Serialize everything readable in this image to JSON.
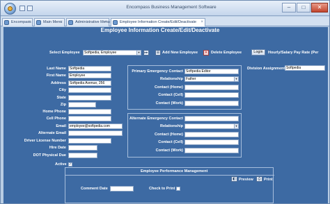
{
  "window": {
    "title": "Encompass Business Management Software",
    "watermark": "SOFTPEDIA"
  },
  "tabs": [
    {
      "label": "Encompass",
      "active": false
    },
    {
      "label": "Main Menu",
      "active": false
    },
    {
      "label": "Administrative Menu",
      "active": false
    },
    {
      "label": "Employee Information Create/Edit/Deactivate",
      "active": true
    }
  ],
  "form": {
    "heading": "Employee Information Create/Edit/Deactivate",
    "select_employee_label": "Select Employee",
    "select_employee_value": "Softpedia, Employee",
    "add_new_label": "Add New Employee",
    "delete_label": "Delete Employee",
    "login_button": "Login",
    "hourly_rate_label": "Hourly/Salary Pay Rate (Per",
    "left_fields": [
      {
        "label": "Last Name",
        "value": "Softpedia"
      },
      {
        "label": "First Name",
        "value": "Employee"
      },
      {
        "label": "Address",
        "value": "Softpedia Avenue, 256"
      },
      {
        "label": "City",
        "value": ""
      },
      {
        "label": "State",
        "value": ""
      },
      {
        "label": "Zip",
        "value": ""
      },
      {
        "label": "Home Phone",
        "value": ""
      },
      {
        "label": "Cell Phone",
        "value": ""
      },
      {
        "label": "Email",
        "value": "employee@softpedia.com"
      },
      {
        "label": "Alternate Email",
        "value": ""
      },
      {
        "label": "Driver License Number",
        "value": ""
      },
      {
        "label": "Hire Date",
        "value": ""
      },
      {
        "label": "DOT Physical Due",
        "value": ""
      }
    ],
    "active_label": "Active",
    "active_checked": true,
    "primary_emergency": {
      "contact_label": "Primary Emergency Contact",
      "contact_value": "Softpedia Editor",
      "relationship_label": "Relationship",
      "relationship_value": "Father",
      "home_label": "Contact (Home)",
      "cell_label": "Contact (Cell)",
      "work_label": "Contact (Work)"
    },
    "alternate_emergency": {
      "contact_label": "Alternate Emergency Contact",
      "relationship_label": "Relationship",
      "home_label": "Contact (Home)",
      "cell_label": "Contact (Cell)",
      "work_label": "Contact (Work)"
    },
    "division_label": "Division Assignment",
    "division_value": "Softpedia",
    "performance": {
      "title": "Employee Performance Management",
      "preview_label": "Preview",
      "print_label": "Print",
      "comment_date_label": "Comment Date",
      "check_to_print_label": "Check to Print"
    }
  }
}
